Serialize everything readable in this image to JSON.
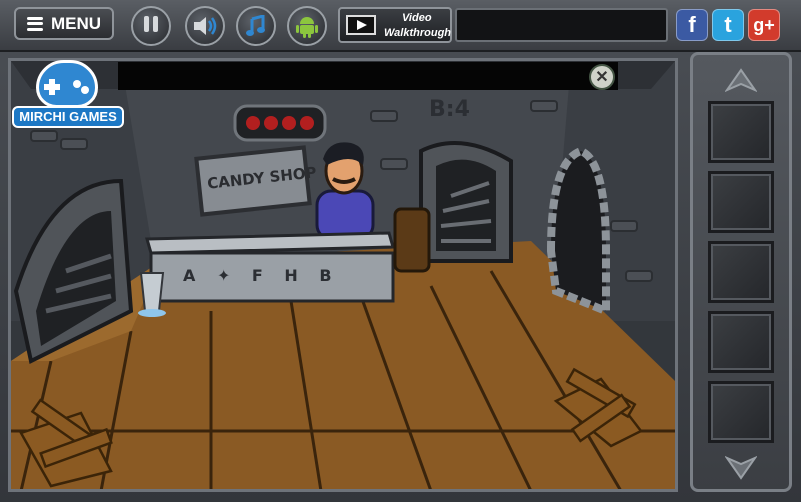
{
  "toolbar": {
    "menu_label": "MENU",
    "pause_icon": "pause-icon",
    "sound_icon": "speaker-icon",
    "music_icon": "music-note-icon",
    "android_icon": "android-icon",
    "video_line1": "Video",
    "video_line2": "Walkthrough",
    "social": [
      {
        "name": "facebook",
        "glyph": "f",
        "color": "#3b5aa3"
      },
      {
        "name": "twitter",
        "glyph": "t",
        "color": "#2aa3de"
      },
      {
        "name": "google-plus",
        "glyph": "g+",
        "color": "#d23b2c"
      }
    ]
  },
  "scene": {
    "logo_text": "MIRCHI GAMES",
    "room_label": "B:4",
    "shop_sign": "CANDY SHOP",
    "counter_symbols": "A ✦ F H B",
    "close_icon": "close-icon"
  },
  "inventory": {
    "up_icon": "arrow-up-icon",
    "down_icon": "arrow-down-icon",
    "slots": 5
  },
  "colors": {
    "floor": "#8a5a24",
    "wall": "#3c4046",
    "accent_blue": "#1d78c5"
  }
}
